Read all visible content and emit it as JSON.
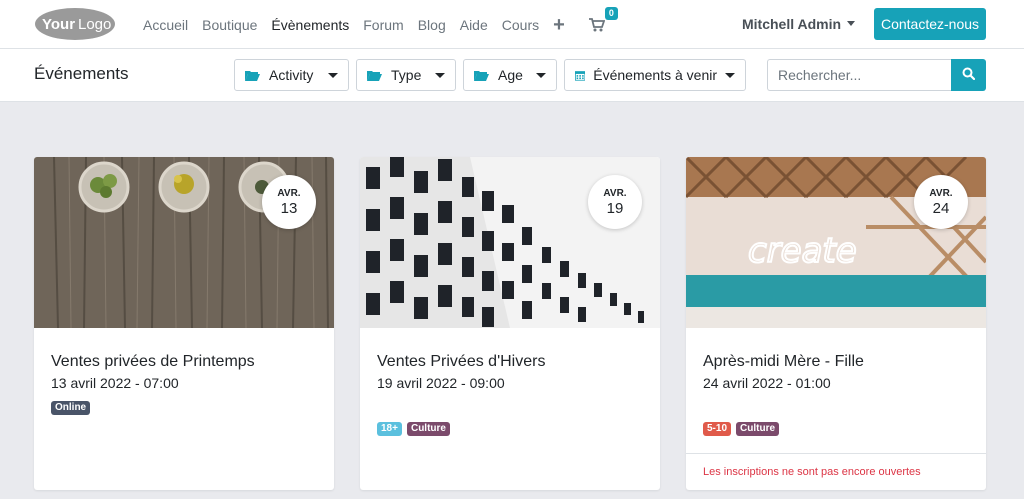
{
  "header": {
    "logo_text": "YourLogo",
    "nav": [
      "Accueil",
      "Boutique",
      "Évènements",
      "Forum",
      "Blog",
      "Aide",
      "Cours"
    ],
    "active_nav": "Évènements",
    "cart_count": "0",
    "user_name": "Mitchell Admin",
    "contact_label": "Contactez-nous"
  },
  "filters": {
    "page_title": "Événements",
    "activity": "Activity",
    "type": "Type",
    "age": "Age",
    "upcoming": "Événements à venir",
    "search_placeholder": "Rechercher..."
  },
  "events": [
    {
      "month": "AVR.",
      "day": "13",
      "title": "Ventes privées de Printemps",
      "date": "13 avril 2022 - 07:00",
      "tags": [
        {
          "label": "Online",
          "color": "#495468"
        }
      ],
      "footer": ""
    },
    {
      "month": "AVR.",
      "day": "19",
      "title": "Ventes Privées d'Hivers",
      "date": "19 avril 2022 - 09:00",
      "tags": [
        {
          "label": "18+",
          "color": "#5bc0de"
        },
        {
          "label": "Culture",
          "color": "#7b4a6b"
        }
      ],
      "footer": ""
    },
    {
      "month": "AVR.",
      "day": "24",
      "title": "Après-midi Mère - Fille",
      "date": "24 avril 2022 - 01:00",
      "tags": [
        {
          "label": "5-10",
          "color": "#e05a4a"
        },
        {
          "label": "Culture",
          "color": "#7b4a6b"
        }
      ],
      "footer": "Les inscriptions ne sont pas encore ouvertes"
    }
  ],
  "colors": {
    "accent": "#17a2b8",
    "danger": "#dc3545"
  }
}
